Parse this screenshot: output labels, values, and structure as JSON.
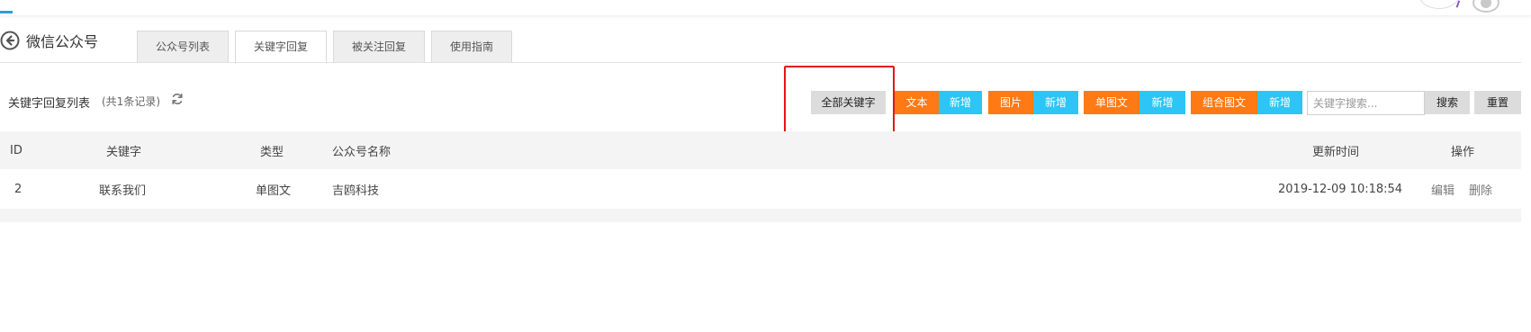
{
  "header": {
    "title": "微信公众号"
  },
  "tabs": [
    {
      "label": "公众号列表",
      "active": false
    },
    {
      "label": "关键字回复",
      "active": true
    },
    {
      "label": "被关注回复",
      "active": false
    },
    {
      "label": "使用指南",
      "active": false
    }
  ],
  "toolbar": {
    "list_title": "关键字回复列表",
    "record_count": "(共1条记录)",
    "all_keywords": "全部关键字",
    "text_label": "文本",
    "image_label": "图片",
    "single_news_label": "单图文",
    "multi_news_label": "组合图文",
    "add_label": "新增",
    "search_placeholder": "关键字搜索...",
    "search_button": "搜索",
    "reset_button": "重置"
  },
  "table": {
    "columns": [
      "ID",
      "关键字",
      "类型",
      "公众号名称",
      "更新时间",
      "操作"
    ],
    "rows": [
      {
        "id": "2",
        "keyword": "联系我们",
        "type": "单图文",
        "account": "吉鸥科技",
        "updated": "2019-12-09 10:18:54",
        "actions": [
          "编辑",
          "删除"
        ]
      }
    ]
  },
  "colors": {
    "orange": "#ff7a14",
    "blue": "#2cc5f5",
    "gray_button": "#dcdcdc",
    "highlight": "#e8131d",
    "table_header_bg": "#f4f4f4"
  },
  "icons": {
    "back": "back-arrow-circle-icon",
    "refresh": "refresh-icon",
    "avatar": "user-avatar-icon"
  }
}
